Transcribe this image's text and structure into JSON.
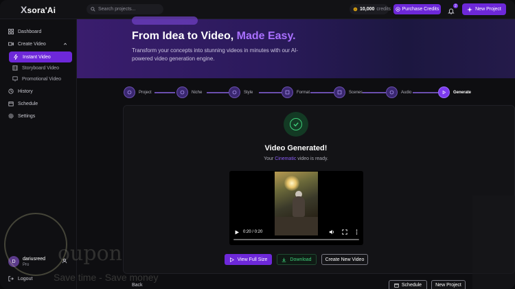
{
  "app": {
    "logo_mark": "X",
    "logo_text": "sora'Ai"
  },
  "topbar": {
    "search_placeholder": "Search projects...",
    "credits_value": "10,000",
    "credits_label": "credits",
    "purchase_label": "Purchase Credits",
    "notification_count": "2",
    "new_project_label": "New Project"
  },
  "sidebar": {
    "dashboard": "Dashboard",
    "create_video": "Create Video",
    "instant_video": "Instant Video",
    "storyboard_video": "Storyboard Video",
    "promotional_video": "Promotional Video",
    "history": "History",
    "schedule": "Schedule",
    "settings": "Settings",
    "user_name": "dariusreed",
    "user_initial": "D",
    "user_plan": "Pro",
    "logout": "Logout"
  },
  "hero": {
    "title_main": "From Idea to Video, ",
    "title_accent": "Made Easy.",
    "subtitle": "Transform your concepts into stunning videos in minutes with our AI-powered video generation engine."
  },
  "steps": [
    "Project",
    "Niche",
    "Style",
    "Format",
    "Scenes",
    "Audio",
    "Generate"
  ],
  "result": {
    "title": "Video Generated!",
    "sub_prefix": "Your ",
    "sub_style": "Cinematic",
    "sub_suffix": " video is ready.",
    "time": "0:20 / 0:20",
    "view_label": "View Full Size",
    "download_label": "Download",
    "new_video_label": "Create New Video"
  },
  "footer": {
    "back": "Back",
    "schedule": "Schedule",
    "new_project": "New Project"
  },
  "watermark": {
    "brand": "oupon",
    "tagline": "Save time - Save money"
  },
  "colors": {
    "accent": "#6d28d9",
    "success": "#3fd07a",
    "background": "#0e0e11"
  }
}
